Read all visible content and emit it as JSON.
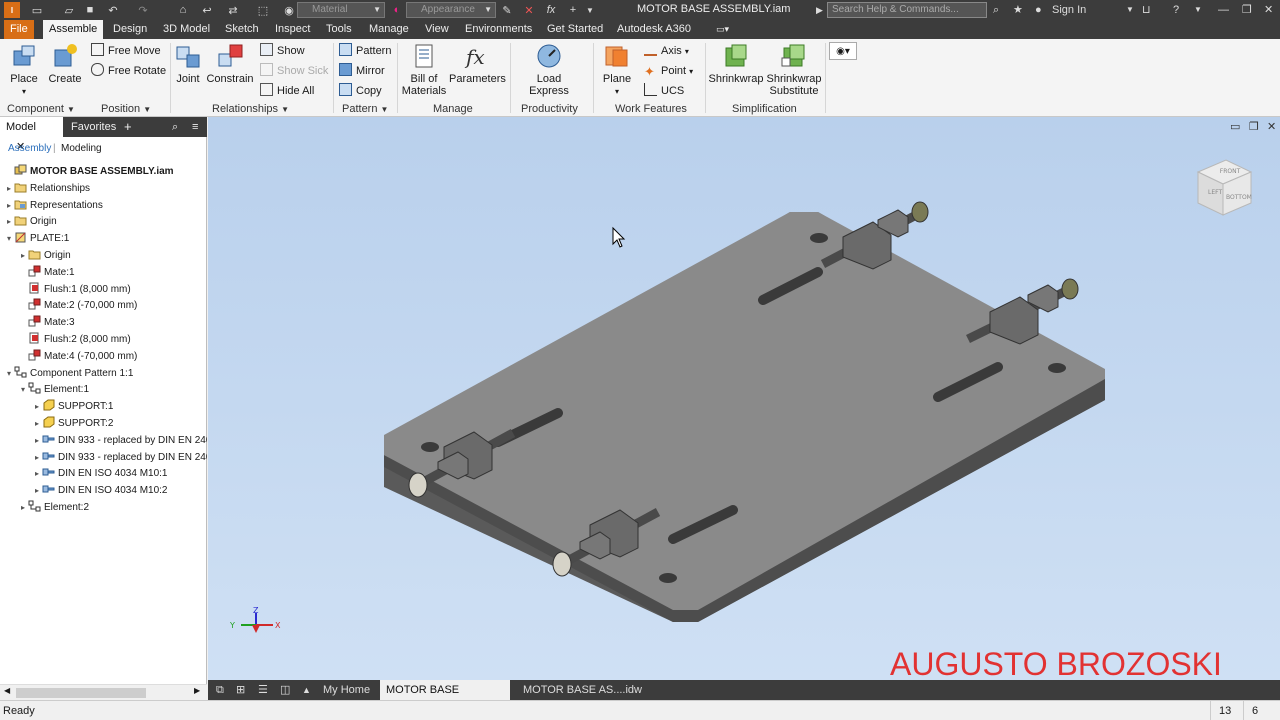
{
  "titlebar": {
    "title": "MOTOR BASE ASSEMBLY.iam",
    "material_placeholder": "Material",
    "appearance_placeholder": "Appearance",
    "fx_label": "fx",
    "search_placeholder": "Search Help & Commands...",
    "sign_in": "Sign In"
  },
  "menu": {
    "tabs": [
      "File",
      "Assemble",
      "Design",
      "3D Model",
      "Sketch",
      "Inspect",
      "Tools",
      "Manage",
      "View",
      "Environments",
      "Get Started",
      "Autodesk A360"
    ],
    "active": "Assemble"
  },
  "ribbon": {
    "place": "Place",
    "create": "Create",
    "free_move": "Free Move",
    "free_rotate": "Free Rotate",
    "joint": "Joint",
    "constrain": "Constrain",
    "show": "Show",
    "show_sick": "Show Sick",
    "hide_all": "Hide All",
    "pattern": "Pattern",
    "mirror": "Mirror",
    "copy": "Copy",
    "bom_line1": "Bill of",
    "bom_line2": "Materials",
    "parameters": "Parameters",
    "load_express": "Load Express",
    "plane": "Plane",
    "axis": "Axis",
    "point": "Point",
    "ucs": "UCS",
    "shrinkwrap": "Shrinkwrap",
    "shrinkwrap_sub1": "Shrinkwrap",
    "shrinkwrap_sub2": "Substitute",
    "panels": {
      "component": "Component",
      "position": "Position",
      "relationships": "Relationships",
      "pattern": "Pattern",
      "manage": "Manage",
      "productivity": "Productivity",
      "work_features": "Work Features",
      "simplification": "Simplification"
    }
  },
  "browser": {
    "tabs": [
      "Model",
      "Favorites"
    ],
    "plus": "+",
    "mode_assembly": "Assembly",
    "mode_sep": "|",
    "mode_modeling": "Modeling",
    "tree": [
      {
        "label": "MOTOR BASE ASSEMBLY.iam",
        "level": 0,
        "toggle": "",
        "icon": "assembly",
        "bold": true
      },
      {
        "label": "Relationships",
        "level": 0,
        "toggle": "▸",
        "icon": "folder"
      },
      {
        "label": "Representations",
        "level": 0,
        "toggle": "▸",
        "icon": "representations"
      },
      {
        "label": "Origin",
        "level": 0,
        "toggle": "▸",
        "icon": "folder"
      },
      {
        "label": "PLATE:1",
        "level": 0,
        "toggle": "▾",
        "icon": "part"
      },
      {
        "label": "Origin",
        "level": 1,
        "toggle": "▸",
        "icon": "folder"
      },
      {
        "label": "Mate:1",
        "level": 1,
        "toggle": "",
        "icon": "mate"
      },
      {
        "label": "Flush:1 (8,000 mm)",
        "level": 1,
        "toggle": "",
        "icon": "flush"
      },
      {
        "label": "Mate:2 (-70,000 mm)",
        "level": 1,
        "toggle": "",
        "icon": "mate"
      },
      {
        "label": "Mate:3",
        "level": 1,
        "toggle": "",
        "icon": "mate"
      },
      {
        "label": "Flush:2 (8,000 mm)",
        "level": 1,
        "toggle": "",
        "icon": "flush"
      },
      {
        "label": "Mate:4 (-70,000 mm)",
        "level": 1,
        "toggle": "",
        "icon": "mate"
      },
      {
        "label": "Component Pattern 1:1",
        "level": 0,
        "toggle": "▾",
        "icon": "pattern"
      },
      {
        "label": "Element:1",
        "level": 1,
        "toggle": "▾",
        "icon": "pattern"
      },
      {
        "label": "SUPPORT:1",
        "level": 2,
        "toggle": "▸",
        "icon": "part-yellow"
      },
      {
        "label": "SUPPORT:2",
        "level": 2,
        "toggle": "▸",
        "icon": "part-yellow"
      },
      {
        "label": "DIN 933 - replaced by DIN EN 240",
        "level": 2,
        "toggle": "▸",
        "icon": "bolt"
      },
      {
        "label": "DIN 933 - replaced by DIN EN 240",
        "level": 2,
        "toggle": "▸",
        "icon": "bolt"
      },
      {
        "label": "DIN EN ISO 4034 M10:1",
        "level": 2,
        "toggle": "▸",
        "icon": "bolt"
      },
      {
        "label": "DIN EN ISO 4034 M10:2",
        "level": 2,
        "toggle": "▸",
        "icon": "bolt"
      },
      {
        "label": "Element:2",
        "level": 1,
        "toggle": "▸",
        "icon": "pattern"
      }
    ]
  },
  "viewcube": {
    "front": "FRONT",
    "left": "LEFT",
    "bottom": "BOTTOM"
  },
  "triad": {
    "x": "X",
    "y": "Y",
    "z": "Z"
  },
  "watermark": "AUGUSTO BROZOSKI",
  "doctabs": {
    "home": "My Home",
    "doc1": "MOTOR BASE AS....iam",
    "doc2": "MOTOR BASE AS....idw"
  },
  "status": {
    "text": "Ready",
    "count1": "13",
    "count2": "6"
  },
  "colors": {
    "accent": "#d86e16",
    "dark_bar": "#3c3c3c",
    "watermark": "#e23232",
    "plate": "#808080"
  }
}
